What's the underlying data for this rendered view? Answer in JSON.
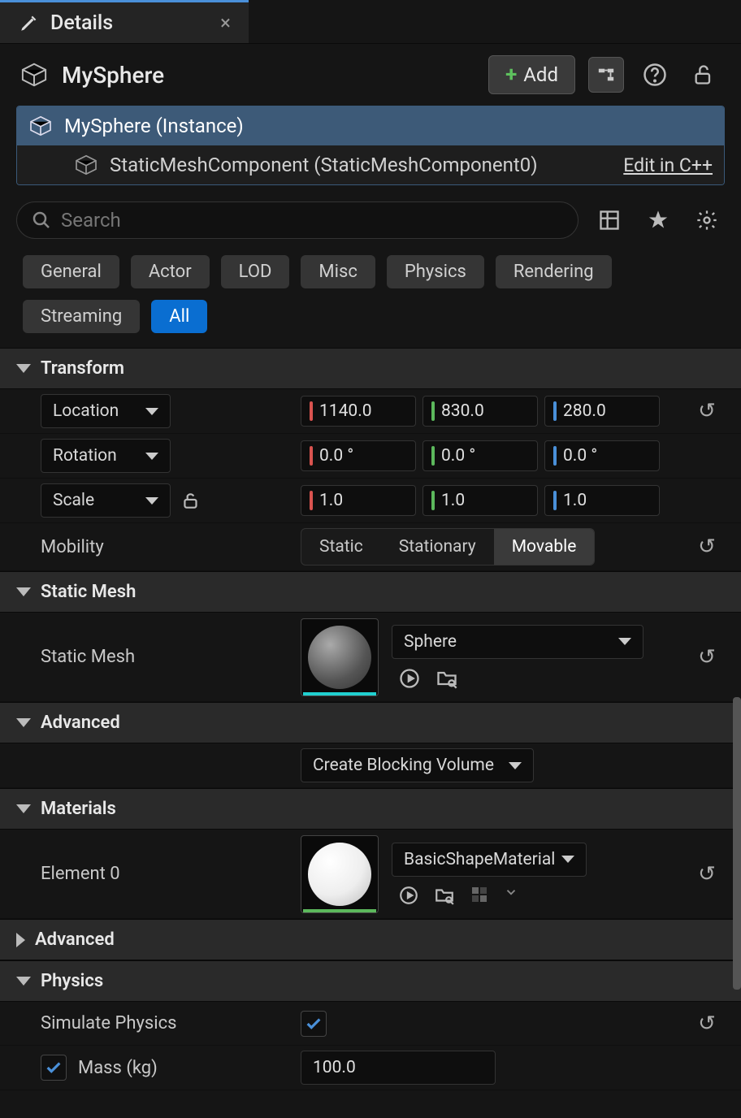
{
  "tab": {
    "title": "Details"
  },
  "actor": {
    "name": "MySphere",
    "add_label": "Add"
  },
  "components": {
    "root": "MySphere (Instance)",
    "child": "StaticMeshComponent (StaticMeshComponent0)",
    "edit_link": "Edit in C++"
  },
  "search": {
    "placeholder": "Search"
  },
  "filters": [
    "General",
    "Actor",
    "LOD",
    "Misc",
    "Physics",
    "Rendering",
    "Streaming",
    "All"
  ],
  "filters_active": "All",
  "sections": {
    "transform": {
      "title": "Transform",
      "location_label": "Location",
      "location": [
        "1140.0",
        "830.0",
        "280.0"
      ],
      "rotation_label": "Rotation",
      "rotation": [
        "0.0 °",
        "0.0 °",
        "0.0 °"
      ],
      "scale_label": "Scale",
      "scale": [
        "1.0",
        "1.0",
        "1.0"
      ],
      "mobility_label": "Mobility",
      "mobility_opts": [
        "Static",
        "Stationary",
        "Movable"
      ],
      "mobility_sel": "Movable"
    },
    "static_mesh": {
      "title": "Static Mesh",
      "label": "Static Mesh",
      "value": "Sphere"
    },
    "advanced1": {
      "title": "Advanced",
      "button": "Create Blocking Volume"
    },
    "materials": {
      "title": "Materials",
      "label": "Element 0",
      "value": "BasicShapeMaterial"
    },
    "advanced2": {
      "title": "Advanced"
    },
    "physics": {
      "title": "Physics",
      "sim_label": "Simulate Physics",
      "sim_checked": true,
      "mass_label": "Mass (kg)",
      "mass_checked": true,
      "mass_value": "100.0"
    }
  }
}
